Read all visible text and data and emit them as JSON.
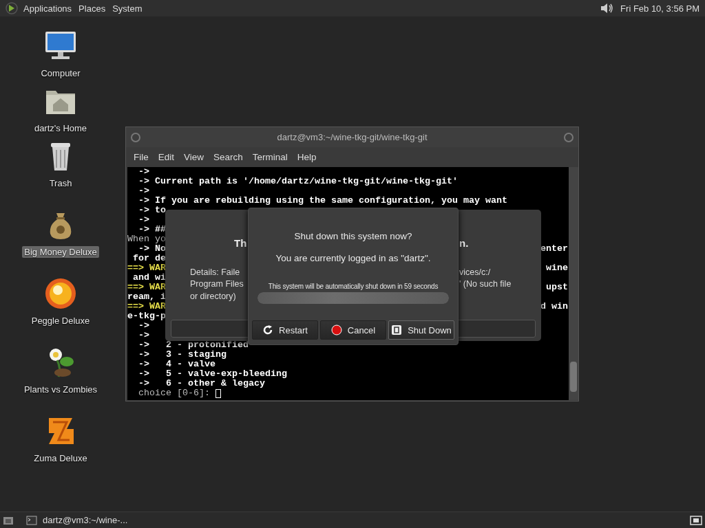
{
  "top_panel": {
    "menus": [
      "Applications",
      "Places",
      "System"
    ],
    "clock": "Fri Feb 10, 3:56 PM"
  },
  "desktop_icons": [
    {
      "label": "Computer",
      "kind": "computer",
      "selected": false
    },
    {
      "label": "dartz's Home",
      "kind": "home",
      "selected": false
    },
    {
      "label": "Trash",
      "kind": "trash",
      "selected": false
    },
    {
      "label": "Big Money Deluxe",
      "kind": "money",
      "selected": true
    },
    {
      "label": "Peggle Deluxe",
      "kind": "ball",
      "selected": false
    },
    {
      "label": "Plants vs Zombies",
      "kind": "flower",
      "selected": false
    },
    {
      "label": "Zuma Deluxe",
      "kind": "block",
      "selected": false
    }
  ],
  "terminal": {
    "title": "dartz@vm3:~/wine-tkg-git/wine-tkg-git",
    "menu": [
      "File",
      "Edit",
      "View",
      "Search",
      "Terminal",
      "Help"
    ],
    "lines": [
      {
        "left": "  ->",
        "kind": "normal"
      },
      {
        "left": "  -> Current path is '/home/dartz/wine-tkg-git/wine-tkg-git'",
        "kind": "normal"
      },
      {
        "left": "  ->",
        "kind": "normal"
      },
      {
        "left": "  -> If you are rebuilding using the same configuration, you may want",
        "kind": "normal"
      },
      {
        "left": "  -> to",
        "kind": "normal"
      },
      {
        "left": "  ->",
        "kind": "normal"
      },
      {
        "left": "  -> ##",
        "kind": "normal"
      },
      {
        "left": "When yo",
        "kind": "dim"
      },
      {
        "left": "  -> No",
        "right": "enter",
        "kind": "normal"
      },
      {
        "left": " for de",
        "kind": "normal"
      },
      {
        "left": "==> WAR",
        "right": "wine",
        "kind": "warn"
      },
      {
        "left": " and wi",
        "kind": "normal"
      },
      {
        "left": "==> WAR",
        "right": "upst",
        "kind": "warn"
      },
      {
        "left": "ream, i",
        "kind": "normal"
      },
      {
        "left": "==> WAR",
        "right": "d win",
        "kind": "warn"
      },
      {
        "left": "e-tkg-p",
        "kind": "normal"
      },
      {
        "left": "  ->",
        "kind": "normal"
      },
      {
        "left": "  ->",
        "kind": "normal"
      },
      {
        "left": "  ->   2 - protonified",
        "kind": "normal"
      },
      {
        "left": "  ->   3 - staging",
        "kind": "normal"
      },
      {
        "left": "  ->   4 - valve",
        "kind": "normal"
      },
      {
        "left": "  ->   5 - valve-exp-bleeding",
        "kind": "normal"
      },
      {
        "left": "  ->   6 - other & legacy",
        "kind": "normal"
      }
    ],
    "prompt": "  choice [0-6]: "
  },
  "error_dialog": {
    "title_left": "Th",
    "title_right": "n.",
    "details": [
      {
        "left": "Details: Faile",
        "right": "vices/c:/"
      },
      {
        "left": "Program Files",
        "right": "' (No such file"
      },
      {
        "left": "or directory)"
      }
    ]
  },
  "shutdown_dialog": {
    "question": "Shut down this system now?",
    "user_line": "You are currently logged in as \"dartz\".",
    "countdown": "This system will be automatically shut down in 59 seconds",
    "progress": {
      "level": 1
    },
    "buttons": [
      {
        "label": "Restart",
        "kind": "restart",
        "selected": false
      },
      {
        "label": "Cancel",
        "kind": "cancel",
        "selected": false
      },
      {
        "label": "Shut Down",
        "kind": "shutdown",
        "selected": true
      }
    ]
  },
  "taskbar": {
    "tasks": [
      {
        "label": "dartz@vm3:~/wine-...",
        "selected": false
      }
    ]
  }
}
